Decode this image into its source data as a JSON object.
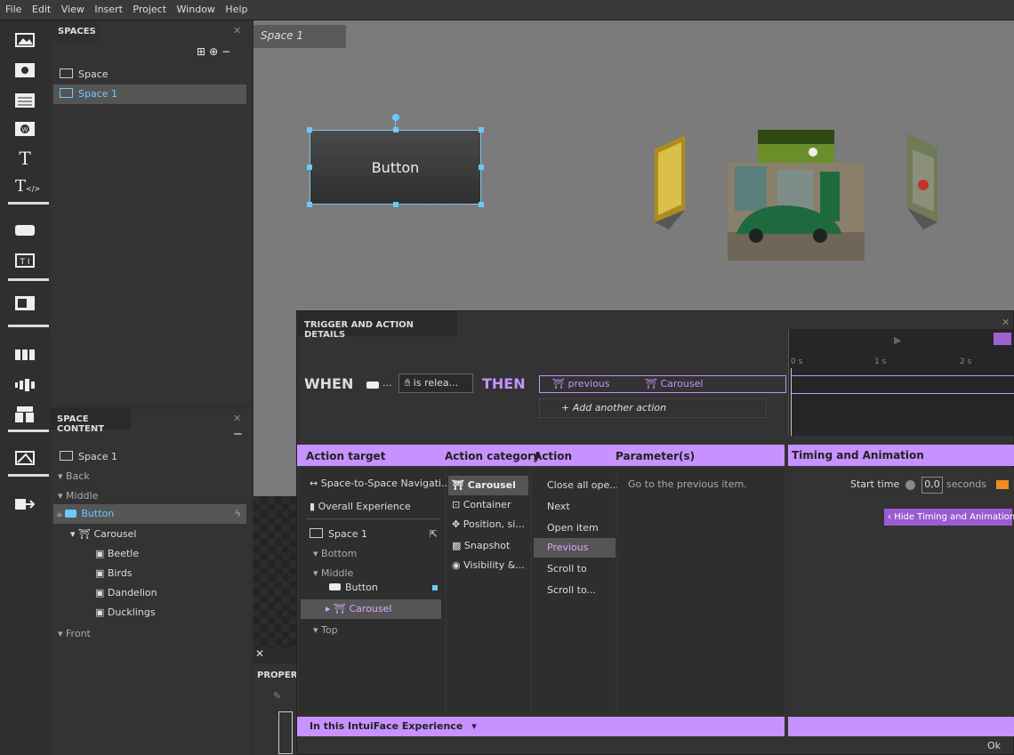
{
  "menu": [
    "File",
    "Edit",
    "View",
    "Insert",
    "Project",
    "Window",
    "Help"
  ],
  "spaces_panel": {
    "title": "SPACES",
    "items": [
      {
        "label": "Space",
        "selected": false
      },
      {
        "label": "Space 1",
        "selected": true
      }
    ]
  },
  "space_content": {
    "title": "SPACE CONTENT",
    "tree": [
      {
        "label": "Space 1",
        "icon": "space-icon"
      },
      {
        "label": "Back",
        "icon": "caret-right-icon"
      },
      {
        "label": "Middle",
        "icon": "caret-down-icon"
      },
      {
        "label": "Button",
        "icon": "button-icon",
        "selected": true
      },
      {
        "label": "Carousel",
        "icon": "carousel-icon"
      },
      {
        "label": "Beetle",
        "icon": "image-icon"
      },
      {
        "label": "Birds",
        "icon": "image-icon"
      },
      {
        "label": "Dandelion",
        "icon": "image-icon"
      },
      {
        "label": "Ducklings",
        "icon": "image-icon"
      },
      {
        "label": "Front",
        "icon": "caret-down-icon"
      }
    ]
  },
  "canvas": {
    "tab": "Space 1",
    "button_label": "Button"
  },
  "properties": {
    "title": "PROPER"
  },
  "dialog": {
    "title": "TRIGGER AND ACTION DETAILS",
    "when": "WHEN",
    "trigger_source": "...",
    "trigger": "is relea...",
    "then": "THEN",
    "action": "previous",
    "action_target": "Carousel",
    "add_action": "+ Add another action",
    "timeline_ticks": [
      "0 s",
      "1 s",
      "2 s"
    ],
    "headers": {
      "target": "Action target",
      "category": "Action category",
      "action": "Action",
      "params": "Parameter(s)",
      "timing": "Timing and Animation"
    },
    "targets": [
      {
        "label": "Space-to-Space Navigati...",
        "icon": "navigation-icon"
      },
      {
        "label": "Overall Experience",
        "icon": "experience-icon"
      },
      {
        "label": "Space 1",
        "icon": "space-icon"
      },
      {
        "label": "Bottom",
        "icon": "caret-down-icon"
      },
      {
        "label": "Middle",
        "icon": "caret-down-icon"
      },
      {
        "label": "Button",
        "icon": "button-icon"
      },
      {
        "label": "Carousel",
        "icon": "carousel-icon"
      },
      {
        "label": "Top",
        "icon": "caret-down-icon"
      }
    ],
    "categories": [
      "Carousel",
      "Container",
      "Position, si...",
      "Snapshot",
      "Visibility &..."
    ],
    "actions": [
      "Close all ope...",
      "Next",
      "Open item",
      "Previous",
      "Scroll to",
      "Scroll to..."
    ],
    "parameter_text": "Go to the previous item.",
    "start_time_label": "Start time",
    "start_time_value": "0,0",
    "seconds": "seconds",
    "hide_timing": "Hide Timing and Animation",
    "footer": "In this IntuiFace Experience",
    "ok": "Ok"
  }
}
